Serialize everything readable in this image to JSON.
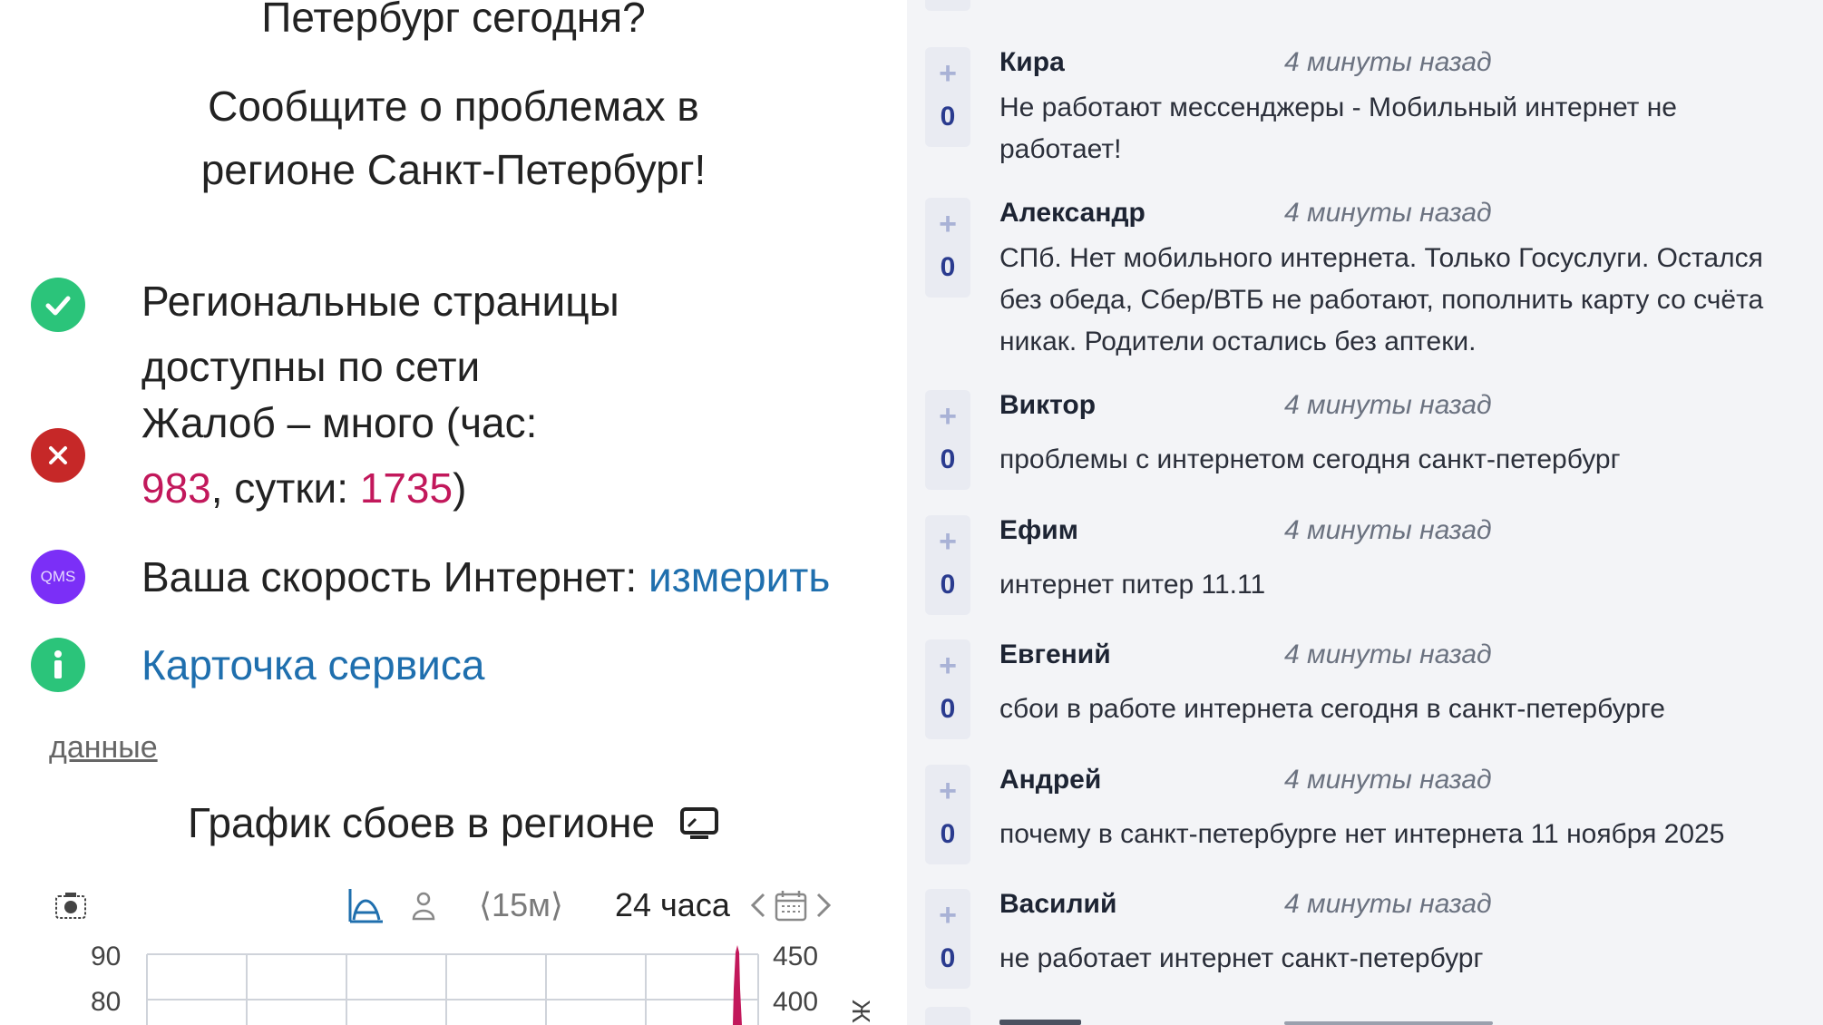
{
  "left": {
    "header_cut": "Петербург сегодня?",
    "report_line1": "Сообщите о проблемах в",
    "report_line2": "регионе Санкт-Петербург!",
    "status_items": [
      {
        "icon": "check-icon",
        "line1": "Региональные страницы",
        "line2": "доступны по сети",
        "color": "#2bc47a"
      },
      {
        "icon": "close-icon",
        "line1": "Жалоб – много (час:",
        "hour_count": "983",
        "mid": ", сутки: ",
        "day_count": "1735",
        "end": ")",
        "color": "#c62828"
      },
      {
        "icon": "qms-icon",
        "label": "Ваша скорость Интернет: ",
        "link": "измерить",
        "badge_text": "QMS",
        "color": "#7b2ff7"
      },
      {
        "icon": "info-icon",
        "link": "Карточка сервиса",
        "color": "#2bc47a"
      }
    ],
    "data_link": "данные",
    "chart_title": "График сбоев в регионе",
    "toolbar": {
      "interval": "⟨15м⟩",
      "range": "24 часа"
    }
  },
  "chart_data": {
    "type": "line",
    "left_axis_ticks": [
      "90",
      "80"
    ],
    "right_axis_ticks": [
      "450",
      "400"
    ],
    "right_axis_label_partial": "Ж"
  },
  "right": {
    "comments": [
      {
        "author": "Кира",
        "time": "4 минуты назад",
        "votes": "0",
        "text": "Не работают мессенджеры - Мобильный интернет не работает!"
      },
      {
        "author": "Александр",
        "time": "4 минуты назад",
        "votes": "0",
        "text": "СПб. Нет мобильного интернета. Только Госуслуги. Остался без обеда, Сбер/ВТБ не работают, пополнить карту со счёта никак. Родители остались без аптеки."
      },
      {
        "author": "Виктор",
        "time": "4 минуты назад",
        "votes": "0",
        "text": "проблемы с интернетом сегодня санкт-петербург"
      },
      {
        "author": "Ефим",
        "time": "4 минуты назад",
        "votes": "0",
        "text": "интернет питер 11.11"
      },
      {
        "author": "Евгений",
        "time": "4 минуты назад",
        "votes": "0",
        "text": "сбои в работе интернета сегодня в санкт-петербурге"
      },
      {
        "author": "Андрей",
        "time": "4 минуты назад",
        "votes": "0",
        "text": "почему в санкт-петербурге нет интернета 11 ноября 2025"
      },
      {
        "author": "Василий",
        "time": "4 минуты назад",
        "votes": "0",
        "text": "не работает интернет санкт-петербург"
      }
    ]
  }
}
